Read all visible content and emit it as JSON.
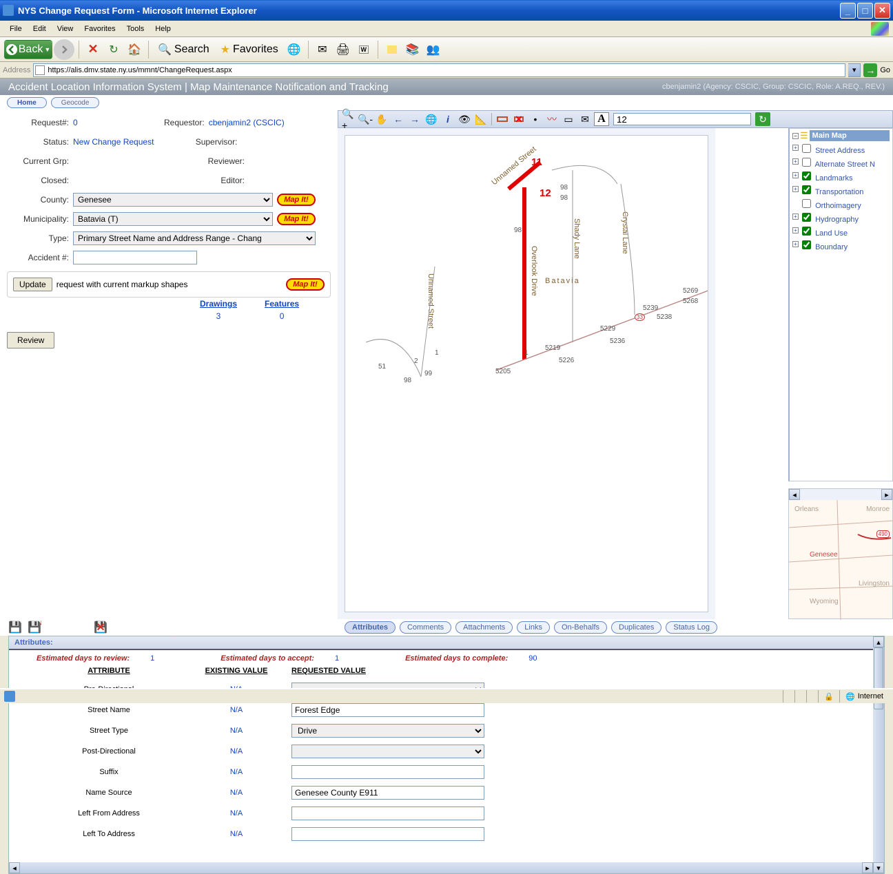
{
  "window": {
    "title": "NYS Change Request Form - Microsoft Internet Explorer"
  },
  "menu": [
    "File",
    "Edit",
    "View",
    "Favorites",
    "Tools",
    "Help"
  ],
  "toolbar": {
    "back": "Back",
    "search": "Search",
    "favorites": "Favorites"
  },
  "address": {
    "label": "Address",
    "url": "https://alis.dmv.state.ny.us/mmnt/ChangeRequest.aspx",
    "go": "Go"
  },
  "banner": {
    "title": "Accident Location Information System | Map Maintenance Notification and Tracking",
    "user": "cbenjamin2 (Agency: CSCIC, Group: CSCIC, Role: A.REQ., REV.)"
  },
  "navtabs": {
    "home": "Home",
    "geocode": "Geocode"
  },
  "form": {
    "labels": {
      "request_no": "Request#:",
      "requestor": "Requestor:",
      "status": "Status:",
      "supervisor": "Supervisor:",
      "current_grp": "Current Grp:",
      "reviewer": "Reviewer:",
      "closed": "Closed:",
      "editor": "Editor:",
      "county": "County:",
      "municipality": "Municipality:",
      "type": "Type:",
      "accident_no": "Accident #:"
    },
    "request_no": "0",
    "requestor": "cbenjamin2 (CSCIC)",
    "status": "New Change Request",
    "supervisor": "",
    "current_grp": "",
    "reviewer": "",
    "closed": "",
    "editor": "",
    "county": "Genesee",
    "municipality": "Batavia (T)",
    "type": "Primary Street Name and Address Range - Chang",
    "accident_no": "",
    "mapit": "Map It!",
    "update_btn": "Update",
    "update_text": "request with current markup shapes",
    "drawings_h": "Drawings",
    "drawings_v": "3",
    "features_h": "Features",
    "features_v": "0",
    "review_btn": "Review"
  },
  "maptb": {
    "text_value": "12"
  },
  "layers": {
    "header": "Main Map",
    "items": [
      {
        "label": "Street Address",
        "checked": false
      },
      {
        "label": "Alternate Street N",
        "checked": false
      },
      {
        "label": "Landmarks",
        "checked": true
      },
      {
        "label": "Transportation",
        "checked": true
      },
      {
        "label": "Orthoimagery",
        "checked": false
      },
      {
        "label": "Hydrography",
        "checked": true
      },
      {
        "label": "Land Use",
        "checked": true
      },
      {
        "label": "Boundary",
        "checked": true
      }
    ]
  },
  "map": {
    "overlay1": "11",
    "overlay2": "12",
    "streets": {
      "unnamed": "Unnamed Street",
      "overlook": "Overlook Drive",
      "shady": "Shady Lane",
      "crystal": "Crystal Lane",
      "batavia": "Batavia"
    },
    "addrs": [
      "51",
      "2",
      "1",
      "99",
      "98",
      "98",
      "98",
      "98",
      "1",
      "5205",
      "5219",
      "5226",
      "5229",
      "5236",
      "5239",
      "5238",
      "5269",
      "5268",
      "33"
    ]
  },
  "minimap": {
    "counties": [
      "Orleans",
      "Monroe",
      "Genesee",
      "Livingston",
      "Wyoming"
    ],
    "hwy": "490"
  },
  "attrtabs": [
    "Attributes",
    "Comments",
    "Attachments",
    "Links",
    "On-Behalfs",
    "Duplicates",
    "Status Log"
  ],
  "attr": {
    "panel_title": "Attributes:",
    "est": {
      "review_l": "Estimated days to review:",
      "review_v": "1",
      "accept_l": "Estimated days to accept:",
      "accept_v": "1",
      "complete_l": "Estimated days to complete:",
      "complete_v": "90"
    },
    "headers": {
      "attr": "ATTRIBUTE",
      "existing": "EXISTING VALUE",
      "requested": "REQUESTED VALUE"
    },
    "rows": [
      {
        "name": "Pre-Directional",
        "existing": "N/A",
        "kind": "select",
        "value": ""
      },
      {
        "name": "Street Name",
        "existing": "N/A",
        "kind": "text",
        "value": "Forest Edge"
      },
      {
        "name": "Street Type",
        "existing": "N/A",
        "kind": "select",
        "value": "Drive"
      },
      {
        "name": "Post-Directional",
        "existing": "N/A",
        "kind": "select",
        "value": ""
      },
      {
        "name": "Suffix",
        "existing": "N/A",
        "kind": "text",
        "value": ""
      },
      {
        "name": "Name Source",
        "existing": "N/A",
        "kind": "text",
        "value": "Genesee County E911"
      },
      {
        "name": "Left From Address",
        "existing": "N/A",
        "kind": "text",
        "value": ""
      },
      {
        "name": "Left To Address",
        "existing": "N/A",
        "kind": "text",
        "value": ""
      }
    ]
  },
  "status": {
    "internet": "Internet"
  }
}
